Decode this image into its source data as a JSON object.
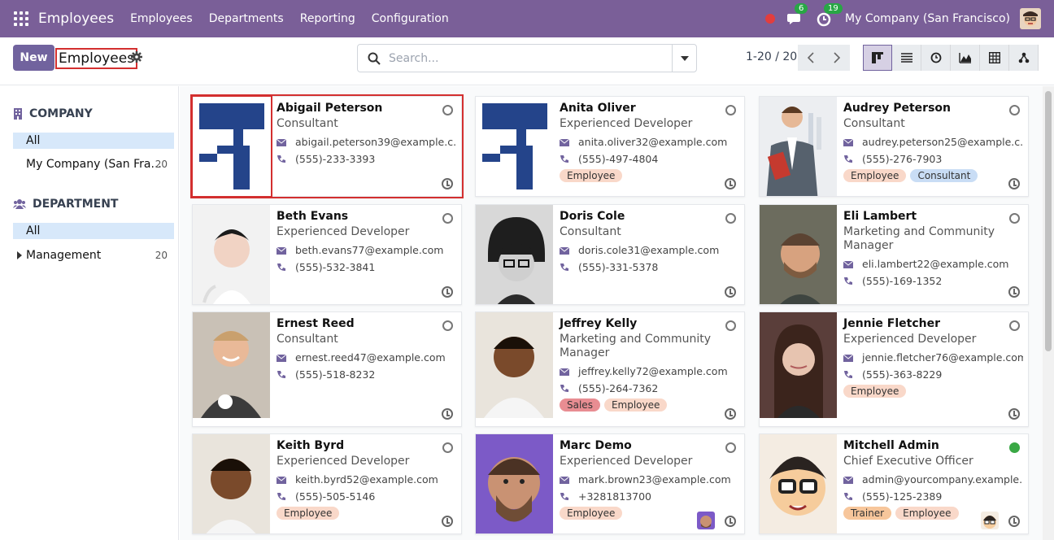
{
  "topbar": {
    "app_name": "Employees",
    "menus": [
      "Employees",
      "Departments",
      "Reporting",
      "Configuration"
    ],
    "messages_count": "6",
    "activities_count": "19",
    "company": "My Company (San Francisco)"
  },
  "control": {
    "new_label": "New",
    "breadcrumb": "Employees",
    "search_placeholder": "Search...",
    "pager": "1-20 / 20"
  },
  "sidebar": {
    "company_heading": "COMPANY",
    "company_items": [
      {
        "label": "All",
        "count": ""
      },
      {
        "label": "My Company (San Fra...",
        "count": "20"
      }
    ],
    "department_heading": "DEPARTMENT",
    "department_items": [
      {
        "label": "All",
        "count": ""
      },
      {
        "label": "Management",
        "count": "20"
      }
    ]
  },
  "colors": {
    "topbar": "#7a5f98",
    "accent": "#71639e",
    "tag_employee": "#f9d8c9",
    "tag_consultant": "#c9ddf5",
    "tag_sales": "#e88d92",
    "tag_trainer": "#f7c69b",
    "online": "#3aa845"
  },
  "cards": [
    {
      "name": "Abigail Peterson",
      "job": "Consultant",
      "email": "abigail.peterson39@example.c...",
      "phone": "(555)-233-3393",
      "tags": [],
      "photo": "logo",
      "online": false
    },
    {
      "name": "Anita Oliver",
      "job": "Experienced Developer",
      "email": "anita.oliver32@example.com",
      "phone": "(555)-497-4804",
      "tags": [
        "Employee"
      ],
      "photo": "logo",
      "online": false
    },
    {
      "name": "Audrey Peterson",
      "job": "Consultant",
      "email": "audrey.peterson25@example.c...",
      "phone": "(555)-276-7903",
      "tags": [
        "Employee",
        "Consultant"
      ],
      "photo": "man-suit",
      "online": false
    },
    {
      "name": "Beth Evans",
      "job": "Experienced Developer",
      "email": "beth.evans77@example.com",
      "phone": "(555)-532-3841",
      "tags": [],
      "photo": "person-light",
      "online": false
    },
    {
      "name": "Doris Cole",
      "job": "Consultant",
      "email": "doris.cole31@example.com",
      "phone": "(555)-331-5378",
      "tags": [],
      "photo": "woman-bw",
      "online": false
    },
    {
      "name": "Eli Lambert",
      "job": "Marketing and Community Manager",
      "email": "eli.lambert22@example.com",
      "phone": "(555)-169-1352",
      "tags": [],
      "photo": "man-beard",
      "online": false
    },
    {
      "name": "Ernest Reed",
      "job": "Consultant",
      "email": "ernest.reed47@example.com",
      "phone": "(555)-518-8232",
      "tags": [],
      "photo": "man-smile",
      "online": false
    },
    {
      "name": "Jeffrey Kelly",
      "job": "Marketing and Community Manager",
      "email": "jeffrey.kelly72@example.com",
      "phone": "(555)-264-7362",
      "tags": [
        "Sales",
        "Employee"
      ],
      "photo": "man-dark",
      "online": false
    },
    {
      "name": "Jennie Fletcher",
      "job": "Experienced Developer",
      "email": "jennie.fletcher76@example.com",
      "phone": "(555)-363-8229",
      "tags": [
        "Employee"
      ],
      "photo": "woman",
      "online": false
    },
    {
      "name": "Keith Byrd",
      "job": "Experienced Developer",
      "email": "keith.byrd52@example.com",
      "phone": "(555)-505-5146",
      "tags": [
        "Employee"
      ],
      "photo": "man-dark",
      "online": false
    },
    {
      "name": "Marc Demo",
      "job": "Experienced Developer",
      "email": "mark.brown23@example.com",
      "phone": "+3281813700",
      "tags": [
        "Employee"
      ],
      "photo": "cartoon-purple",
      "online": false
    },
    {
      "name": "Mitchell Admin",
      "job": "Chief Executive Officer",
      "email": "admin@yourcompany.example...",
      "phone": "(555)-125-2389",
      "tags": [
        "Trainer",
        "Employee"
      ],
      "photo": "cartoon-glasses",
      "online": true
    }
  ]
}
